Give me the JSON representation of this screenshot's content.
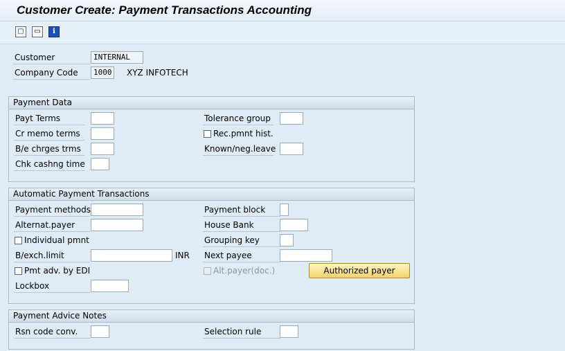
{
  "window": {
    "title": "Customer Create: Payment Transactions Accounting"
  },
  "toolbar": {
    "buttons": [
      {
        "icon": "other-screen-icon"
      },
      {
        "icon": "document-icon"
      },
      {
        "icon": "info-icon",
        "glyph": "i"
      }
    ]
  },
  "header": {
    "customer_label": "Customer",
    "customer_value": "INTERNAL",
    "company_code_label": "Company Code",
    "company_code_value": "1000",
    "company_name": "XYZ INFOTECH"
  },
  "payment_data": {
    "title": "Payment Data",
    "payt_terms": "Payt Terms",
    "cr_memo_terms": "Cr memo terms",
    "be_charges_terms": "B/e chrges trms",
    "chk_cashing_time": "Chk cashng time",
    "tolerance_group": "Tolerance group",
    "rec_pmnt_hist": "Rec.pmnt hist.",
    "known_neg_leave": "Known/neg.leave"
  },
  "automatic_payment": {
    "title": "Automatic Payment Transactions",
    "payment_methods": "Payment methods",
    "alternat_payer": "Alternat.payer",
    "individual_pmnt": "Individual pmnt",
    "bexch_limit": "B/exch.limit",
    "currency": "INR",
    "pmt_adv_edi": "Pmt adv. by EDI",
    "lockbox": "Lockbox",
    "payment_block": "Payment block",
    "house_bank": "House Bank",
    "grouping_key": "Grouping key",
    "next_payee": "Next payee",
    "alt_payer_doc": "Alt.payer(doc.)",
    "authorized_payer_button": "Authorized payer"
  },
  "payment_advice": {
    "title": "Payment Advice Notes",
    "rsn_code_conv": "Rsn code conv.",
    "selection_rule": "Selection rule"
  },
  "colors": {
    "background": "#dfebf5",
    "button_accent": "#f3d26b"
  }
}
